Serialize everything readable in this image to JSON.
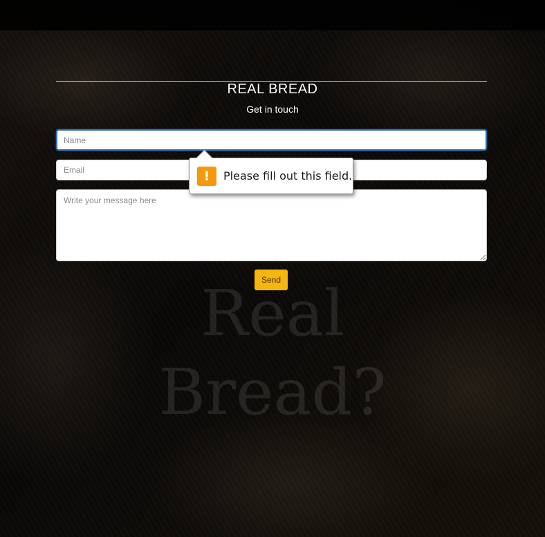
{
  "brand": {
    "title": "REAL BREAD"
  },
  "contact": {
    "subtitle": "Get in touch",
    "name_placeholder": "Name",
    "email_placeholder": "Email",
    "message_placeholder": "Write your message here",
    "send_label": "Send"
  },
  "validation": {
    "message": "Please fill out this field.",
    "icon": "warning-icon",
    "icon_glyph": "!",
    "icon_color": "#f39a0c"
  },
  "background": {
    "watermark_line1": "Real",
    "watermark_line2": "Bread?"
  },
  "colors": {
    "accent": "#f5b70f",
    "focus": "#2f6fb5"
  }
}
